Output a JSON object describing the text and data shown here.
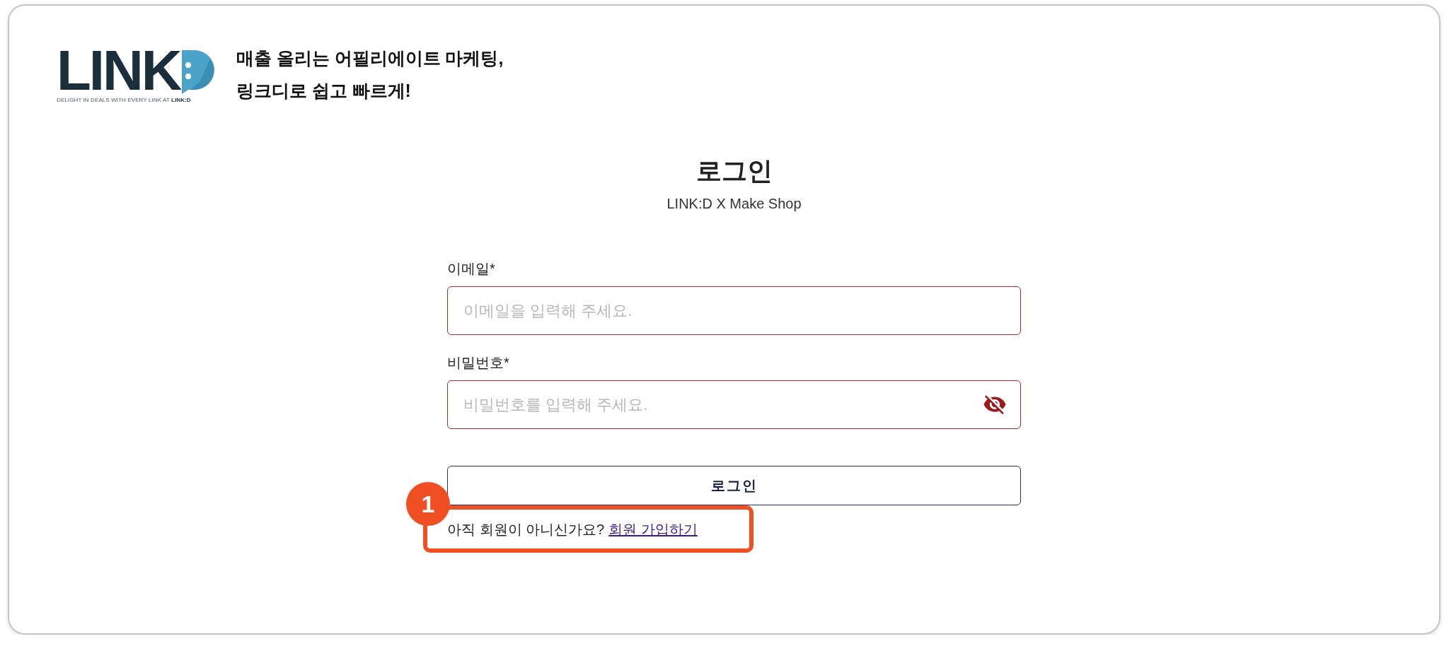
{
  "logo": {
    "wordmark": "LINK",
    "tagline": "DELIGHT IN DEALS WITH EVERY LINK AT **LINK:D**"
  },
  "headline": [
    "매출 올리는 어필리에이트 마케팅,",
    "링크디로 쉽고 빠르게!"
  ],
  "login": {
    "title": "로그인",
    "subtitle": "LINK:D X Make Shop",
    "fields": [
      {
        "kind": "email",
        "label": "이메일*",
        "placeholder": "이메일을 입력해 주세요.",
        "error": true
      },
      {
        "kind": "password",
        "label": "비밀번호*",
        "placeholder": "비밀번호를 입력해 주세요.",
        "error": true,
        "password_visible": false
      }
    ],
    "submit": "로그인",
    "signup": {
      "prompt": "아직 회원이 아니신가요?",
      "link": "회원 가입하기"
    }
  },
  "callout": {
    "number": "1"
  }
}
